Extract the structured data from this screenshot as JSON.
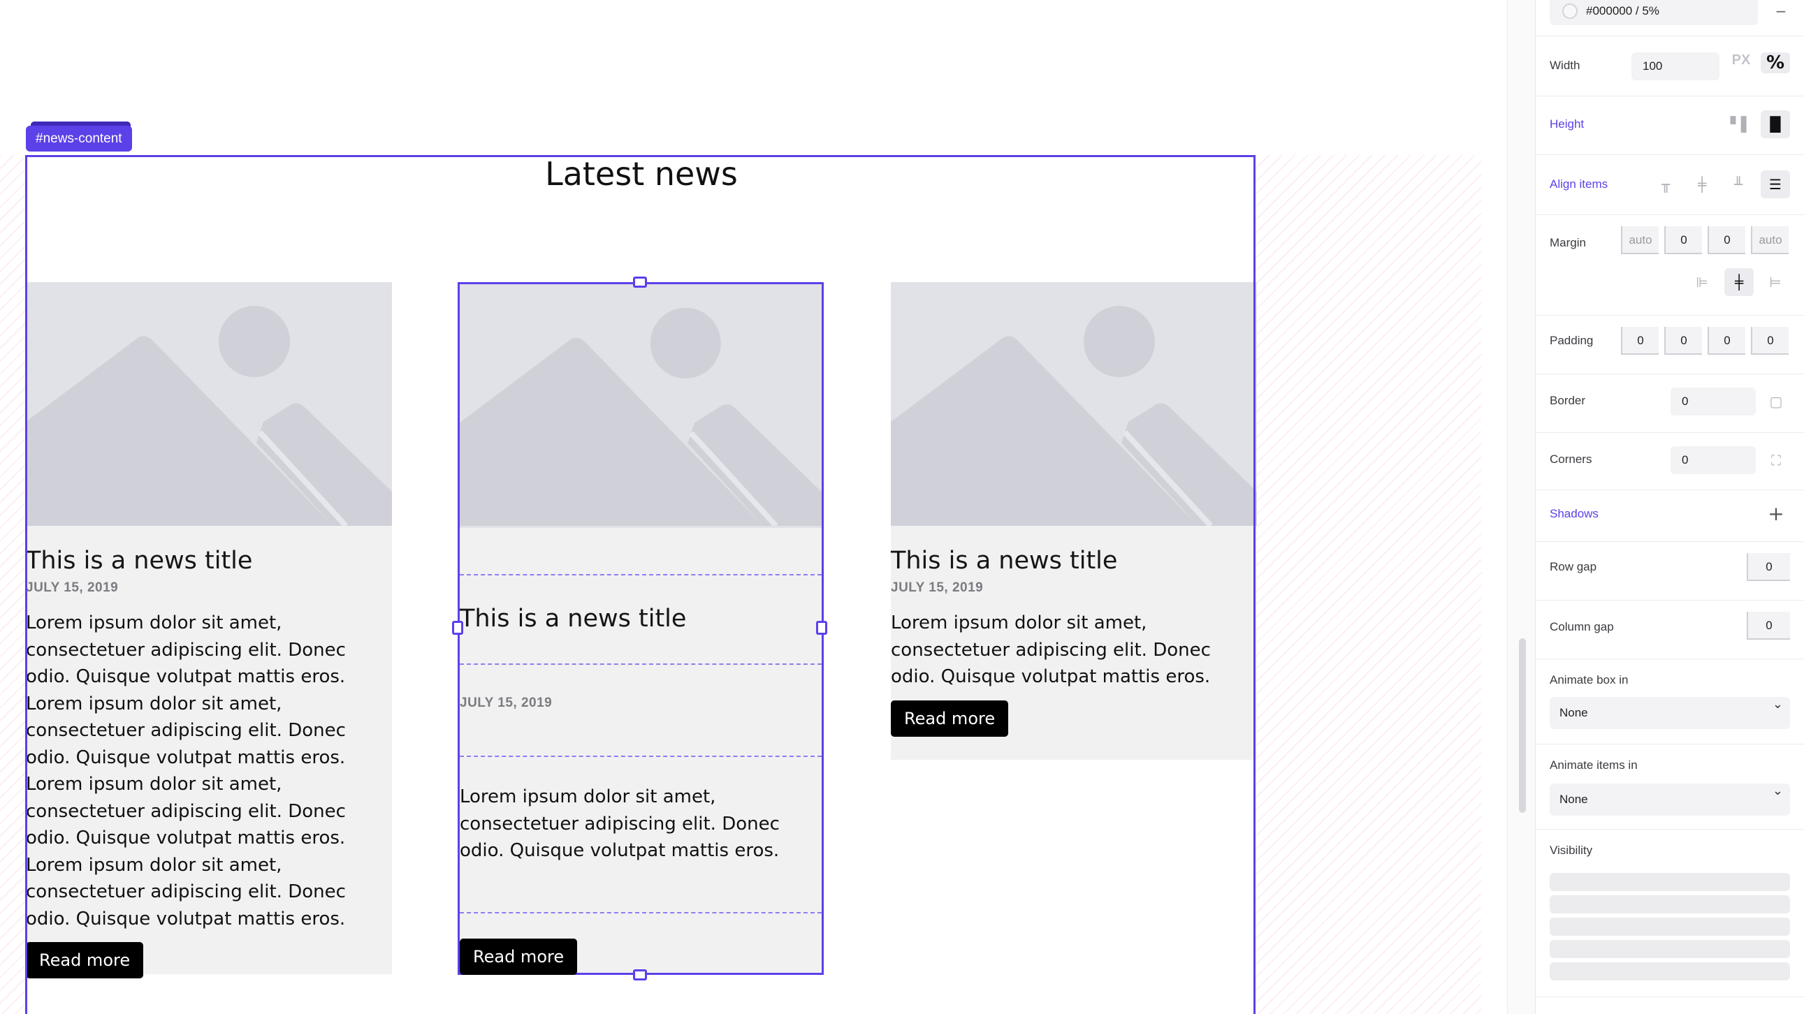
{
  "canvas": {
    "selection_tag": "#news-content",
    "section_title": "Latest news",
    "cards": [
      {
        "title": "This is a news title",
        "date": "JULY 15, 2019",
        "body": "Lorem ipsum dolor sit amet, consectetuer adipiscing elit. Donec odio. Quisque volutpat mattis eros. Lorem ipsum dolor sit amet, consectetuer adipiscing elit. Donec odio. Quisque volutpat mattis eros. Lorem ipsum dolor sit amet, consectetuer adipiscing elit. Donec odio. Quisque volutpat mattis eros. Lorem ipsum dolor sit amet, consectetuer adipiscing elit. Donec odio. Quisque volutpat mattis eros.",
        "button": "Read more"
      },
      {
        "title": "This is a news title",
        "date": "JULY 15, 2019",
        "body": "Lorem ipsum dolor sit amet, consectetuer adipiscing elit. Donec odio. Quisque volutpat mattis eros.",
        "button": "Read more"
      },
      {
        "title": "This is a news title",
        "date": "JULY 15, 2019",
        "body": "Lorem ipsum dolor sit amet, consectetuer adipiscing elit. Donec odio. Quisque volutpat mattis eros.",
        "button": "Read more"
      }
    ]
  },
  "panel": {
    "background_color": "#000000 / 5%",
    "width": {
      "label": "Width",
      "value": "100",
      "unit_px": "PX",
      "unit_pct": "%"
    },
    "height": {
      "label": "Height"
    },
    "align_items": {
      "label": "Align items"
    },
    "margin": {
      "label": "Margin",
      "left": "auto",
      "top": "0",
      "bottom": "0",
      "right": "auto"
    },
    "padding": {
      "label": "Padding",
      "values": [
        "0",
        "0",
        "0",
        "0"
      ]
    },
    "border": {
      "label": "Border",
      "value": "0"
    },
    "corners": {
      "label": "Corners",
      "value": "0"
    },
    "shadows": {
      "label": "Shadows"
    },
    "row_gap": {
      "label": "Row gap",
      "value": "0"
    },
    "column_gap": {
      "label": "Column gap",
      "value": "0"
    },
    "animate_box_in": {
      "label": "Animate box in",
      "value": "None"
    },
    "animate_items_in": {
      "label": "Animate items in",
      "value": "None"
    },
    "visibility": {
      "label": "Visibility"
    }
  },
  "colors": {
    "accent": "#5b41e8",
    "card_bg": "#f1f1f2",
    "image_placeholder": "#e1e2e7"
  }
}
